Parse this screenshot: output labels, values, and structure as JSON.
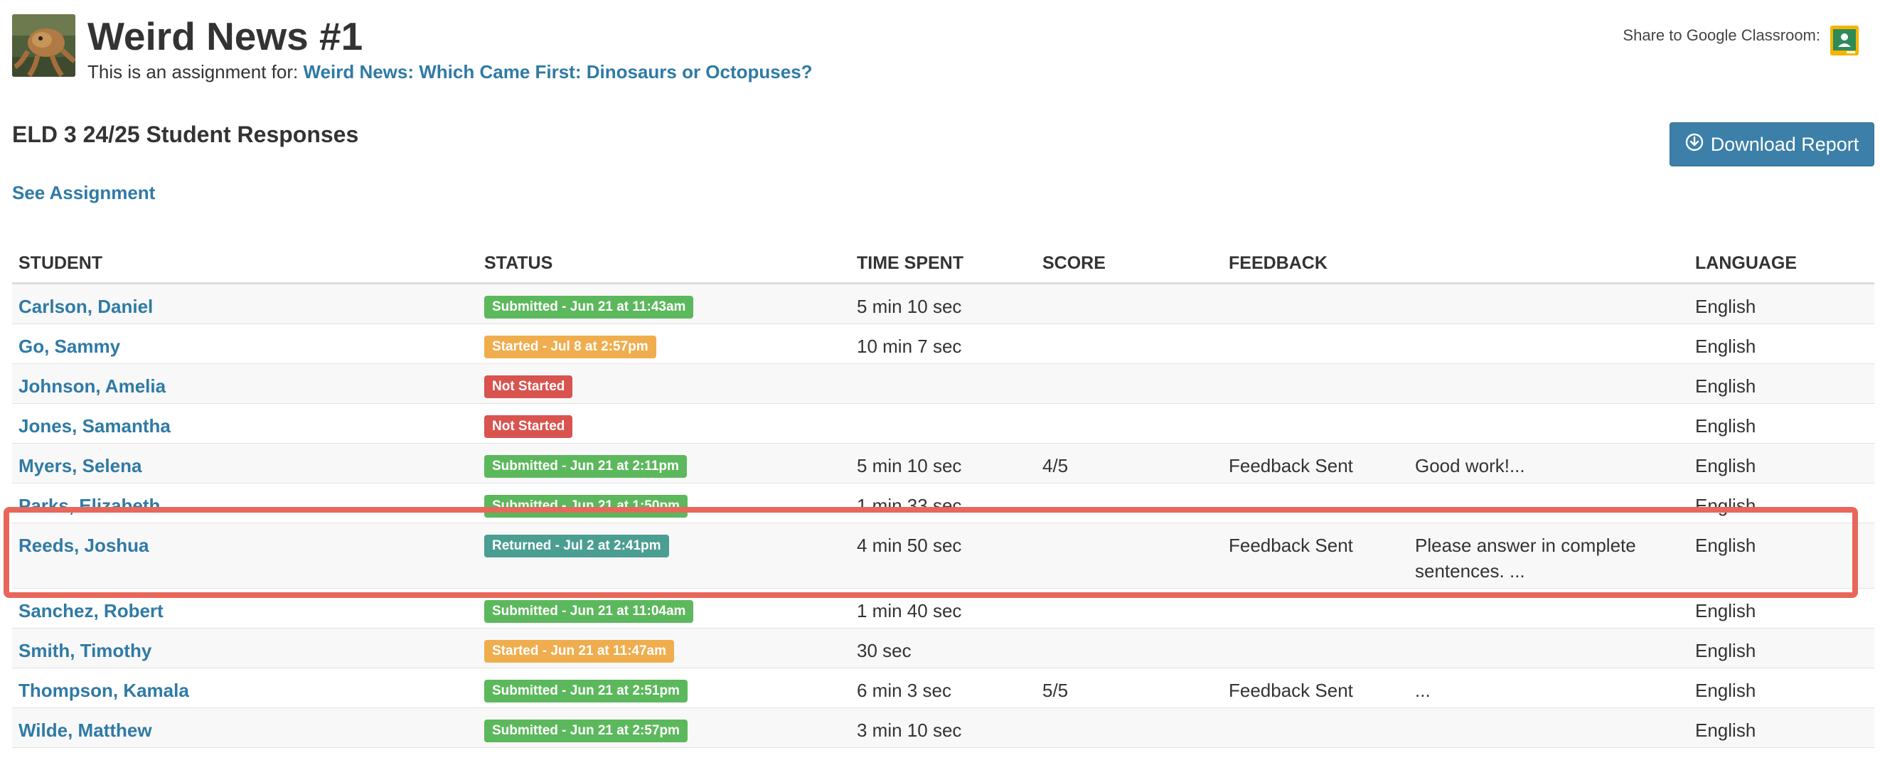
{
  "header": {
    "title": "Weird News #1",
    "assignment_prefix": "This is an assignment for:",
    "assignment_link": "Weird News: Which Came First: Dinosaurs or Octopuses?",
    "share_label": "Share to Google Classroom:"
  },
  "section": {
    "title": "ELD 3 24/25 Student Responses",
    "download_label": "Download Report",
    "see_assignment": "See Assignment"
  },
  "table": {
    "columns": [
      "STUDENT",
      "STATUS",
      "TIME SPENT",
      "SCORE",
      "FEEDBACK",
      "LANGUAGE"
    ],
    "rows": [
      {
        "student": "Carlson, Daniel",
        "status": "Submitted - Jun 21 at 11:43am",
        "status_type": "submitted",
        "time": "5 min 10 sec",
        "score": "",
        "feedback": "",
        "comment": "",
        "language": "English"
      },
      {
        "student": "Go, Sammy",
        "status": "Started - Jul 8 at 2:57pm",
        "status_type": "started",
        "time": "10 min 7 sec",
        "score": "",
        "feedback": "",
        "comment": "",
        "language": "English"
      },
      {
        "student": "Johnson, Amelia",
        "status": "Not Started",
        "status_type": "not-started",
        "time": "",
        "score": "",
        "feedback": "",
        "comment": "",
        "language": "English"
      },
      {
        "student": "Jones, Samantha",
        "status": "Not Started",
        "status_type": "not-started",
        "time": "",
        "score": "",
        "feedback": "",
        "comment": "",
        "language": "English"
      },
      {
        "student": "Myers, Selena",
        "status": "Submitted - Jun 21 at 2:11pm",
        "status_type": "submitted",
        "time": "5 min 10 sec",
        "score": "4/5",
        "feedback": "Feedback Sent",
        "comment": "Good work!...",
        "language": "English"
      },
      {
        "student": "Parks, Elizabeth",
        "status": "Submitted - Jun 21 at 1:50pm",
        "status_type": "submitted",
        "time": "1 min 33 sec",
        "score": "",
        "feedback": "",
        "comment": "",
        "language": "English"
      },
      {
        "student": "Reeds, Joshua",
        "status": "Returned - Jul 2 at 2:41pm",
        "status_type": "returned",
        "time": "4 min 50 sec",
        "score": "",
        "feedback": "Feedback Sent",
        "comment": "Please answer in complete sentences. ...",
        "language": "English"
      },
      {
        "student": "Sanchez, Robert",
        "status": "Submitted - Jun 21 at 11:04am",
        "status_type": "submitted",
        "time": "1 min 40 sec",
        "score": "",
        "feedback": "",
        "comment": "",
        "language": "English"
      },
      {
        "student": "Smith, Timothy",
        "status": "Started - Jun 21 at 11:47am",
        "status_type": "started",
        "time": "30 sec",
        "score": "",
        "feedback": "",
        "comment": "",
        "language": "English"
      },
      {
        "student": "Thompson, Kamala",
        "status": "Submitted - Jun 21 at 2:51pm",
        "status_type": "submitted",
        "time": "6 min 3 sec",
        "score": "5/5",
        "feedback": "Feedback Sent",
        "comment": "...",
        "language": "English"
      },
      {
        "student": "Wilde, Matthew",
        "status": "Submitted - Jun 21 at 2:57pm",
        "status_type": "submitted",
        "time": "3 min 10 sec",
        "score": "",
        "feedback": "",
        "comment": "",
        "language": "English"
      }
    ]
  },
  "colors": {
    "link": "#2f7aa5",
    "submitted": "#5cb85c",
    "started": "#f0ad4e",
    "not-started": "#d9534f",
    "returned": "#4a9e92",
    "highlight": "#e8675a"
  },
  "icons": {
    "download": "download-circle-icon",
    "classroom": "google-classroom-icon"
  }
}
